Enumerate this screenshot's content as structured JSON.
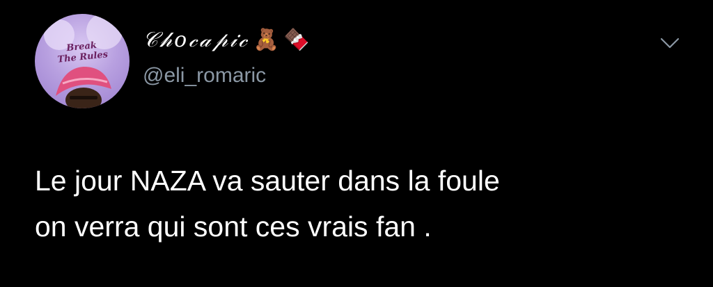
{
  "tweet": {
    "author": {
      "display_name": "𝒞𝒽𝑜𝒸𝒶𝓅𝒾𝒸",
      "emoji_1": "🧸",
      "emoji_2": "🍫",
      "handle": "@eli_romaric",
      "avatar_text_line1": "Break",
      "avatar_text_line2": "The Rules"
    },
    "menu_icon": "chevron-down-icon",
    "text_lines": [
      "Le jour NAZA va sauter dans la foule",
      "on verra qui sont ces vrais fan ."
    ]
  },
  "colors": {
    "background": "#000000",
    "text": "#ffffff",
    "secondary_text": "#8b98a5"
  }
}
